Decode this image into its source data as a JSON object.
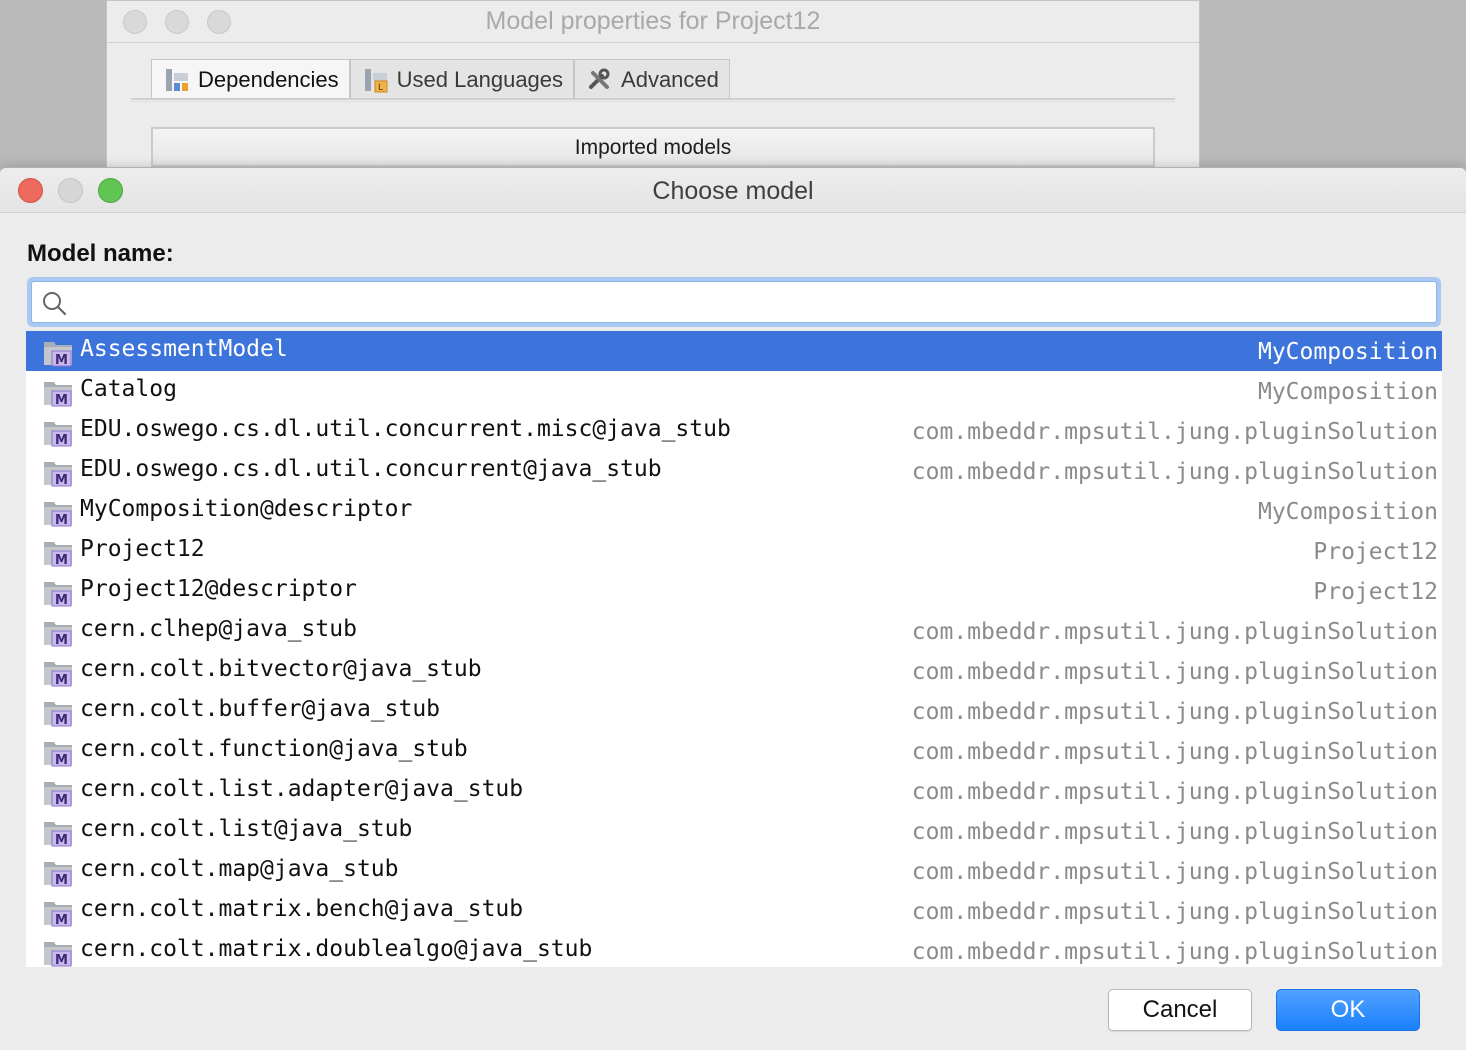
{
  "background_window": {
    "title": "Model properties for Project12",
    "tabs": [
      {
        "label": "Dependencies",
        "icon": "dependencies-icon",
        "active": true
      },
      {
        "label": "Used Languages",
        "icon": "used-languages-icon",
        "active": false
      },
      {
        "label": "Advanced",
        "icon": "tools-icon",
        "active": false
      }
    ],
    "imported_header": "Imported models"
  },
  "dialog": {
    "title": "Choose model",
    "field_label": "Model name:",
    "search": {
      "value": "",
      "placeholder": ""
    },
    "models": [
      {
        "name": "AssessmentModel",
        "module": "MyComposition",
        "selected": true
      },
      {
        "name": "Catalog",
        "module": "MyComposition"
      },
      {
        "name": "EDU.oswego.cs.dl.util.concurrent.misc@java_stub",
        "module": "com.mbeddr.mpsutil.jung.pluginSolution"
      },
      {
        "name": "EDU.oswego.cs.dl.util.concurrent@java_stub",
        "module": "com.mbeddr.mpsutil.jung.pluginSolution"
      },
      {
        "name": "MyComposition@descriptor",
        "module": "MyComposition"
      },
      {
        "name": "Project12",
        "module": "Project12"
      },
      {
        "name": "Project12@descriptor",
        "module": "Project12"
      },
      {
        "name": "cern.clhep@java_stub",
        "module": "com.mbeddr.mpsutil.jung.pluginSolution"
      },
      {
        "name": "cern.colt.bitvector@java_stub",
        "module": "com.mbeddr.mpsutil.jung.pluginSolution"
      },
      {
        "name": "cern.colt.buffer@java_stub",
        "module": "com.mbeddr.mpsutil.jung.pluginSolution"
      },
      {
        "name": "cern.colt.function@java_stub",
        "module": "com.mbeddr.mpsutil.jung.pluginSolution"
      },
      {
        "name": "cern.colt.list.adapter@java_stub",
        "module": "com.mbeddr.mpsutil.jung.pluginSolution"
      },
      {
        "name": "cern.colt.list@java_stub",
        "module": "com.mbeddr.mpsutil.jung.pluginSolution"
      },
      {
        "name": "cern.colt.map@java_stub",
        "module": "com.mbeddr.mpsutil.jung.pluginSolution"
      },
      {
        "name": "cern.colt.matrix.bench@java_stub",
        "module": "com.mbeddr.mpsutil.jung.pluginSolution"
      },
      {
        "name": "cern.colt.matrix.doublealgo@java_stub",
        "module": "com.mbeddr.mpsutil.jung.pluginSolution"
      }
    ],
    "buttons": {
      "cancel": "Cancel",
      "ok": "OK"
    }
  },
  "colors": {
    "selection": "#3c74dc",
    "ok_button": "#1a80fb",
    "module_text": "#8b8b8b",
    "close": "#ed6a5e",
    "zoom": "#61c554"
  }
}
